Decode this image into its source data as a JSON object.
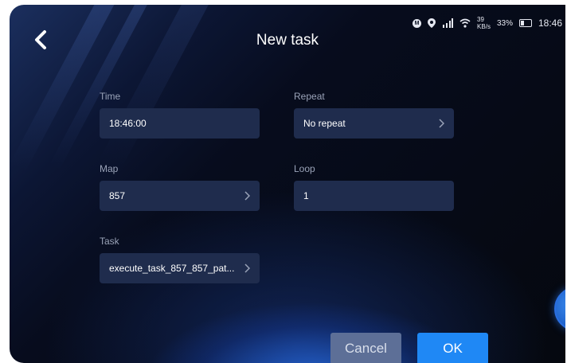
{
  "header": {
    "title": "New task"
  },
  "status_bar": {
    "icons": [
      "m-notification-icon",
      "location-icon",
      "signal-icon",
      "wifi-icon"
    ],
    "speed_value": "39",
    "speed_unit": "KB/s",
    "battery_percent": "33%",
    "battery_level": 0.33,
    "time": "18:46"
  },
  "form": {
    "time": {
      "label": "Time",
      "value": "18:46:00"
    },
    "repeat": {
      "label": "Repeat",
      "value": "No repeat"
    },
    "map": {
      "label": "Map",
      "value": "857"
    },
    "loop": {
      "label": "Loop",
      "value": "1"
    },
    "task": {
      "label": "Task",
      "value": "execute_task_857_857_pat..."
    }
  },
  "actions": {
    "cancel_label": "Cancel",
    "ok_label": "OK"
  },
  "colors": {
    "accent": "#1f88f5",
    "field_bg": "#1f2c4d",
    "cancel_bg": "#5d6f97",
    "background": "#05080f"
  }
}
